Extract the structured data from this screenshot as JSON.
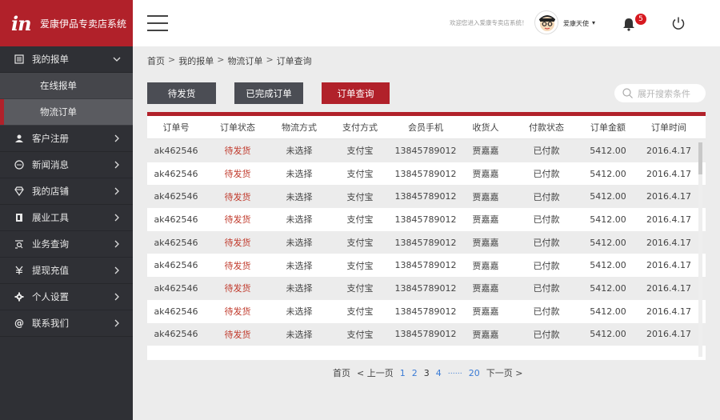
{
  "brand": {
    "logo": "in",
    "name": "爱康伊品专卖店系统"
  },
  "sidebar": {
    "items": [
      {
        "label": "我的报单",
        "icon": "list-icon",
        "expanded": true,
        "sub": [
          {
            "label": "在线报单",
            "active": false
          },
          {
            "label": "物流订单",
            "active": true
          }
        ]
      },
      {
        "label": "客户注册",
        "icon": "users-icon"
      },
      {
        "label": "新闻消息",
        "icon": "chat-icon"
      },
      {
        "label": "我的店铺",
        "icon": "diamond-icon"
      },
      {
        "label": "展业工具",
        "icon": "book-icon"
      },
      {
        "label": "业务查询",
        "icon": "search-list-icon"
      },
      {
        "label": "提现充值",
        "icon": "yen-icon"
      },
      {
        "label": "个人设置",
        "icon": "gear-icon"
      },
      {
        "label": "联系我们",
        "icon": "at-icon"
      }
    ]
  },
  "topbar": {
    "welcome": "欢迎您进入爱康专卖店系统！",
    "username": "爱康天使",
    "notification_count": "5"
  },
  "breadcrumb": [
    "首页",
    "我的报单",
    "物流订单",
    "订单查询"
  ],
  "buttons": {
    "pending": "待发货",
    "completed": "已完成订单",
    "query": "订单查询"
  },
  "search": {
    "placeholder": "展开搜索条件"
  },
  "table": {
    "columns": [
      "订单号",
      "订单状态",
      "物流方式",
      "支付方式",
      "会员手机",
      "收货人",
      "付款状态",
      "订单金额",
      "订单时间"
    ],
    "rows": [
      [
        "ak462546",
        "待发货",
        "未选择",
        "支付宝",
        "13845789012",
        "贾嘉嘉",
        "已付款",
        "5412.00",
        "2016.4.17"
      ],
      [
        "ak462546",
        "待发货",
        "未选择",
        "支付宝",
        "13845789012",
        "贾嘉嘉",
        "已付款",
        "5412.00",
        "2016.4.17"
      ],
      [
        "ak462546",
        "待发货",
        "未选择",
        "支付宝",
        "13845789012",
        "贾嘉嘉",
        "已付款",
        "5412.00",
        "2016.4.17"
      ],
      [
        "ak462546",
        "待发货",
        "未选择",
        "支付宝",
        "13845789012",
        "贾嘉嘉",
        "已付款",
        "5412.00",
        "2016.4.17"
      ],
      [
        "ak462546",
        "待发货",
        "未选择",
        "支付宝",
        "13845789012",
        "贾嘉嘉",
        "已付款",
        "5412.00",
        "2016.4.17"
      ],
      [
        "ak462546",
        "待发货",
        "未选择",
        "支付宝",
        "13845789012",
        "贾嘉嘉",
        "已付款",
        "5412.00",
        "2016.4.17"
      ],
      [
        "ak462546",
        "待发货",
        "未选择",
        "支付宝",
        "13845789012",
        "贾嘉嘉",
        "已付款",
        "5412.00",
        "2016.4.17"
      ],
      [
        "ak462546",
        "待发货",
        "未选择",
        "支付宝",
        "13845789012",
        "贾嘉嘉",
        "已付款",
        "5412.00",
        "2016.4.17"
      ],
      [
        "ak462546",
        "待发货",
        "未选择",
        "支付宝",
        "13845789012",
        "贾嘉嘉",
        "已付款",
        "5412.00",
        "2016.4.17"
      ]
    ]
  },
  "pagination": {
    "first": "首页",
    "prev": "上一页",
    "pages": [
      "1",
      "2",
      "3",
      "4"
    ],
    "current": "3",
    "ellipsis": "……",
    "last_page": "20",
    "next": "下一页"
  },
  "colors": {
    "brand_red": "#b1212a",
    "sidebar_bg": "#2f3035",
    "status_red": "#c0392b",
    "link_blue": "#3a7bd5"
  }
}
